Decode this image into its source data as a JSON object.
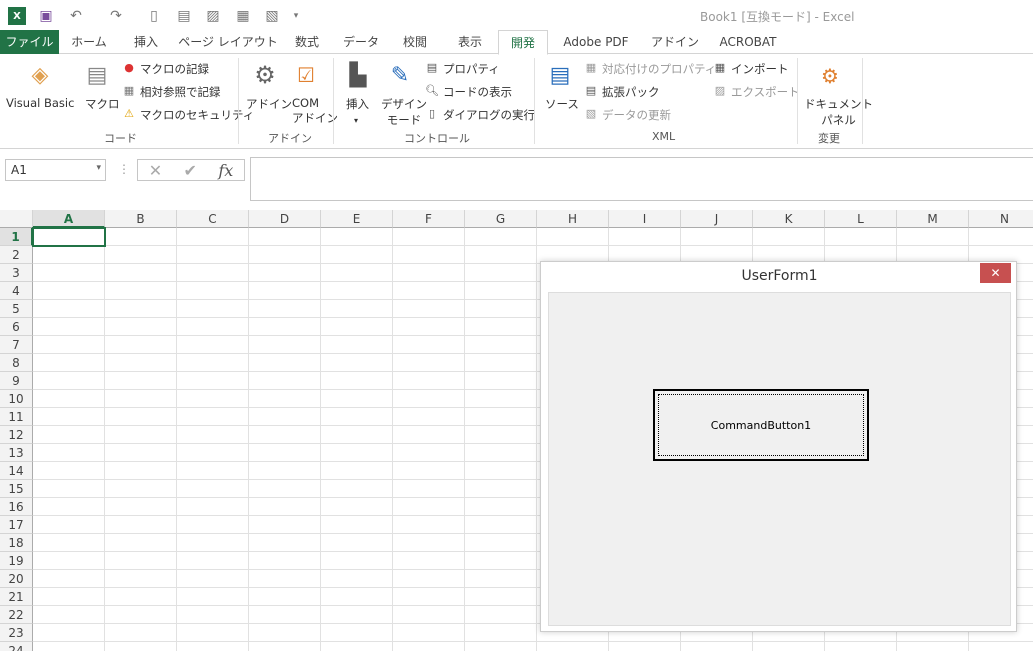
{
  "window": {
    "title": "Book1  [互換モード] - Excel"
  },
  "tabs": [
    {
      "label": "ファイル"
    },
    {
      "label": "ホーム"
    },
    {
      "label": "挿入"
    },
    {
      "label": "ページ レイアウト"
    },
    {
      "label": "数式"
    },
    {
      "label": "データ"
    },
    {
      "label": "校閲"
    },
    {
      "label": "表示"
    },
    {
      "label": "開発"
    },
    {
      "label": "Adobe PDF"
    },
    {
      "label": "アドイン"
    },
    {
      "label": "ACROBAT"
    }
  ],
  "ribbon": {
    "code": {
      "group": "コード",
      "visual_basic": "Visual Basic",
      "macro": "マクロ",
      "record": "マクロの記録",
      "relative": "相対参照で記録",
      "security": "マクロのセキュリティ"
    },
    "addins": {
      "group": "アドイン",
      "addin": "アドイン",
      "com1": "COM",
      "com2": "アドイン"
    },
    "controls": {
      "group": "コントロール",
      "insert": "挿入",
      "design1": "デザイン",
      "design2": "モード",
      "properties": "プロパティ",
      "view_code": "コードの表示",
      "run_dialog": "ダイアログの実行"
    },
    "xml": {
      "group": "XML",
      "source": "ソース",
      "map_props": "対応付けのプロパティ",
      "expansion": "拡張パック",
      "refresh": "データの更新",
      "import": "インポート",
      "export": "エクスポート"
    },
    "modify": {
      "group": "変更",
      "doc1": "ドキュメント",
      "doc2": "パネル"
    }
  },
  "formula_bar": {
    "name_box": "A1",
    "cancel": "✕",
    "enter": "✔",
    "fx": "fx",
    "value": ""
  },
  "sheet": {
    "columns": [
      "A",
      "B",
      "C",
      "D",
      "E",
      "F",
      "G",
      "H",
      "I",
      "J",
      "K",
      "L",
      "M",
      "N"
    ],
    "rows": [
      "1",
      "2",
      "3",
      "4",
      "5",
      "6",
      "7",
      "8",
      "9",
      "10",
      "11",
      "12",
      "13",
      "14",
      "15",
      "16",
      "17",
      "18",
      "19",
      "20",
      "21",
      "22",
      "23",
      "24"
    ],
    "active_cell": "A1"
  },
  "userform": {
    "title": "UserForm1",
    "close": "✕",
    "button": "CommandButton1"
  },
  "colors": {
    "excel_green": "#217346",
    "close_red": "#c75050"
  }
}
